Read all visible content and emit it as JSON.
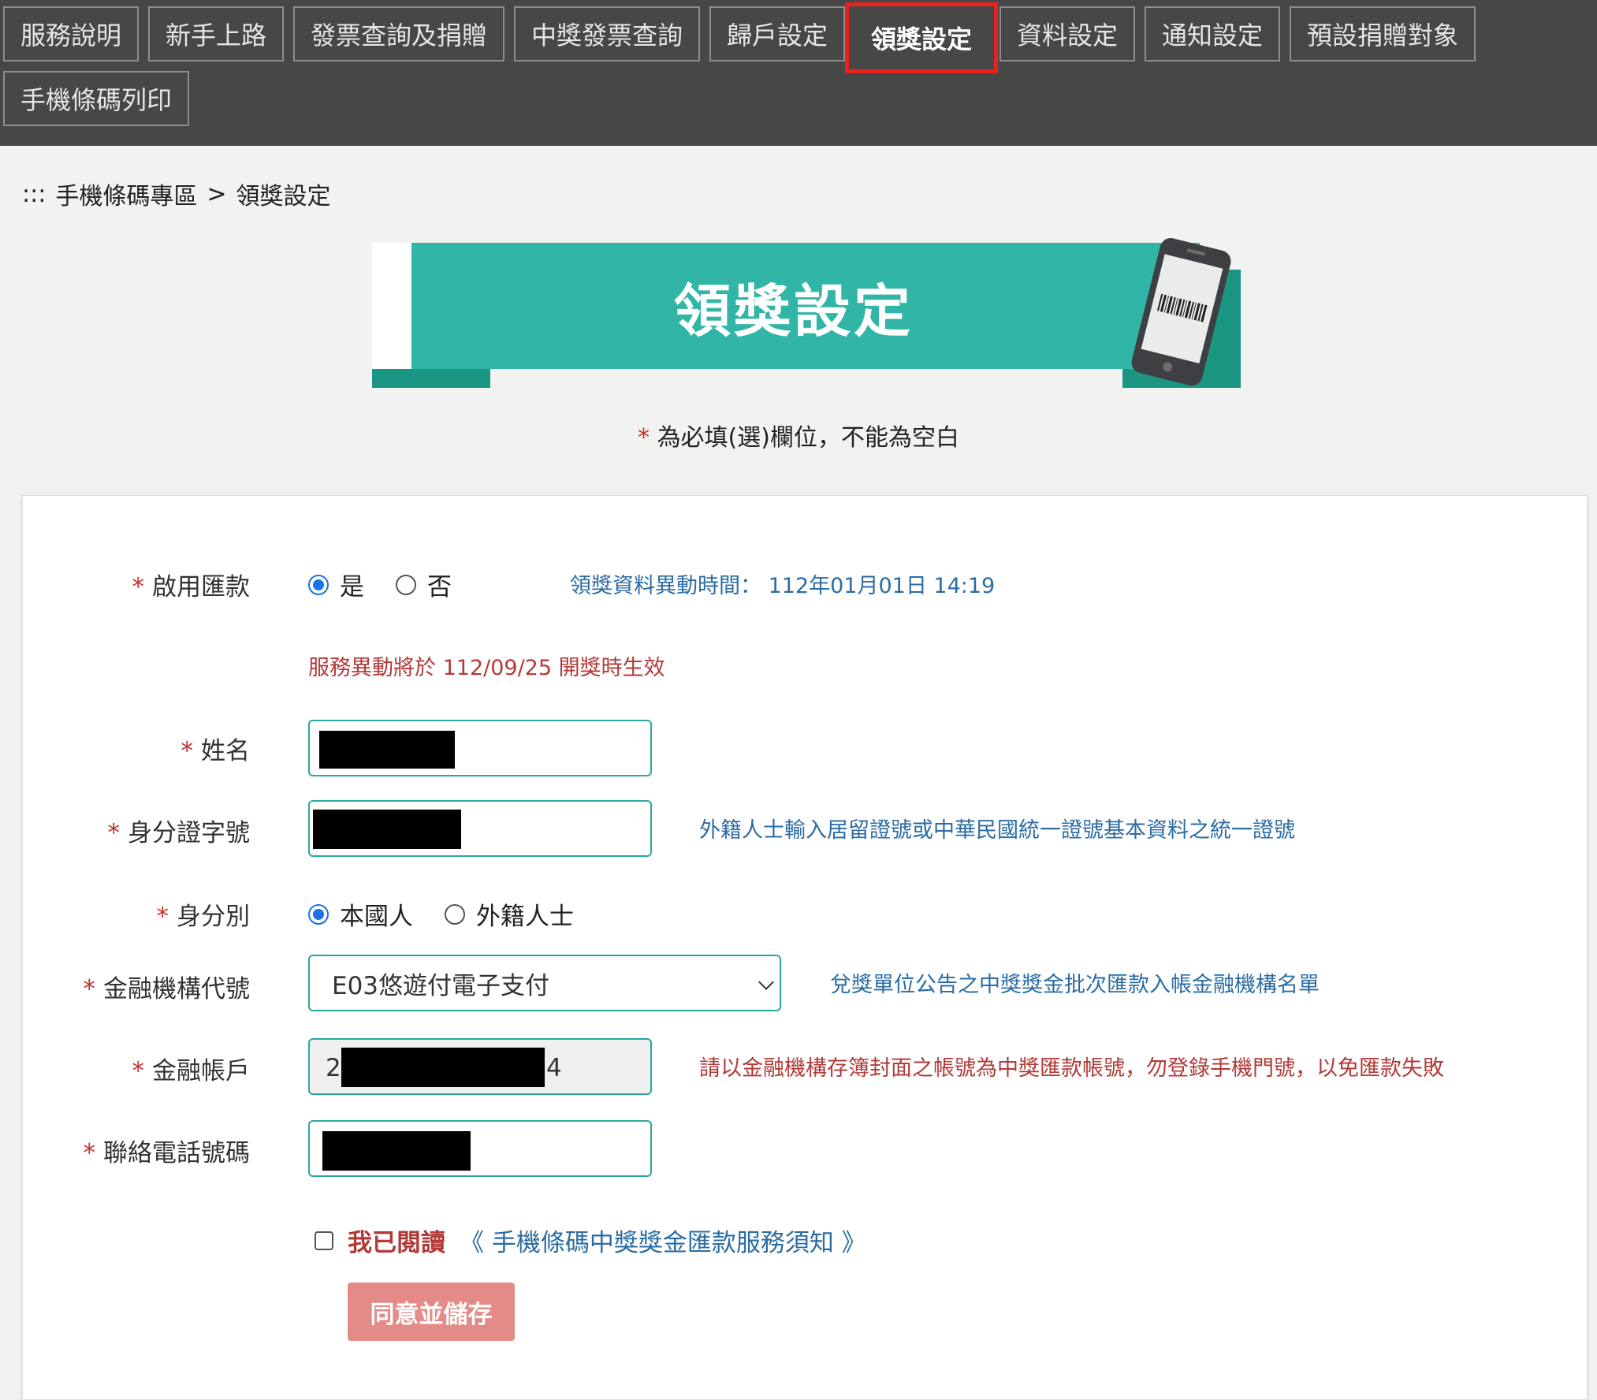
{
  "nav": {
    "items": [
      {
        "label": "服務說明"
      },
      {
        "label": "新手上路"
      },
      {
        "label": "發票查詢及捐贈"
      },
      {
        "label": "中獎發票查詢"
      },
      {
        "label": "歸戶設定"
      },
      {
        "label": "領獎設定",
        "active": true
      },
      {
        "label": "資料設定"
      },
      {
        "label": "通知設定"
      },
      {
        "label": "預設捐贈對象"
      },
      {
        "label": "手機條碼列印"
      }
    ]
  },
  "breadcrumb": {
    "prefix": ":::",
    "parent": "手機條碼專區",
    "separator": ">",
    "current": "領獎設定"
  },
  "banner": {
    "title": "領獎設定",
    "icon": "phone-barcode-icon"
  },
  "required_note": {
    "star": "*",
    "text": "為必填(選)欄位，不能為空白"
  },
  "form": {
    "remittance": {
      "label": "啟用匯款",
      "option_yes": "是",
      "option_no": "否",
      "selected": "是",
      "change_time_label": "領獎資料異動時間：",
      "change_time_value": "112年01月01日 14:19",
      "effective_note": "服務異動將於 112/09/25 開獎時生效"
    },
    "name": {
      "label": "姓名",
      "value_redacted": true
    },
    "id_number": {
      "label": "身分證字號",
      "hint": "外籍人士輸入居留證號或中華民國統一證號基本資料之統一證號"
    },
    "identity": {
      "label": "身分別",
      "option_local": "本國人",
      "option_foreign": "外籍人士",
      "selected": "本國人"
    },
    "bank_code": {
      "label": "金融機構代號",
      "selected": "E03悠遊付電子支付",
      "hint": "兌獎單位公告之中獎獎金批次匯款入帳金融機構名單"
    },
    "bank_account": {
      "label": "金融帳戶",
      "value_start": "2",
      "value_end": "4",
      "hint": "請以金融機構存簿封面之帳號為中獎匯款帳號，勿登錄手機門號，以免匯款失敗"
    },
    "phone": {
      "label": "聯絡電話號碼"
    },
    "agree": {
      "text": "我已閱讀",
      "link": "《 手機條碼中獎獎金匯款服務須知 》",
      "checked": false
    },
    "submit_label": "同意並儲存"
  },
  "colors": {
    "nav_bg": "#474747",
    "active_border": "#e8231c",
    "banner_teal": "#31b5a6",
    "banner_dark_teal": "#1a9683",
    "field_border": "#2aa89c",
    "required_red": "#c8302c",
    "info_blue": "#2b6ca3",
    "info_red": "#b23a37",
    "submit_bg": "#e48b87"
  }
}
